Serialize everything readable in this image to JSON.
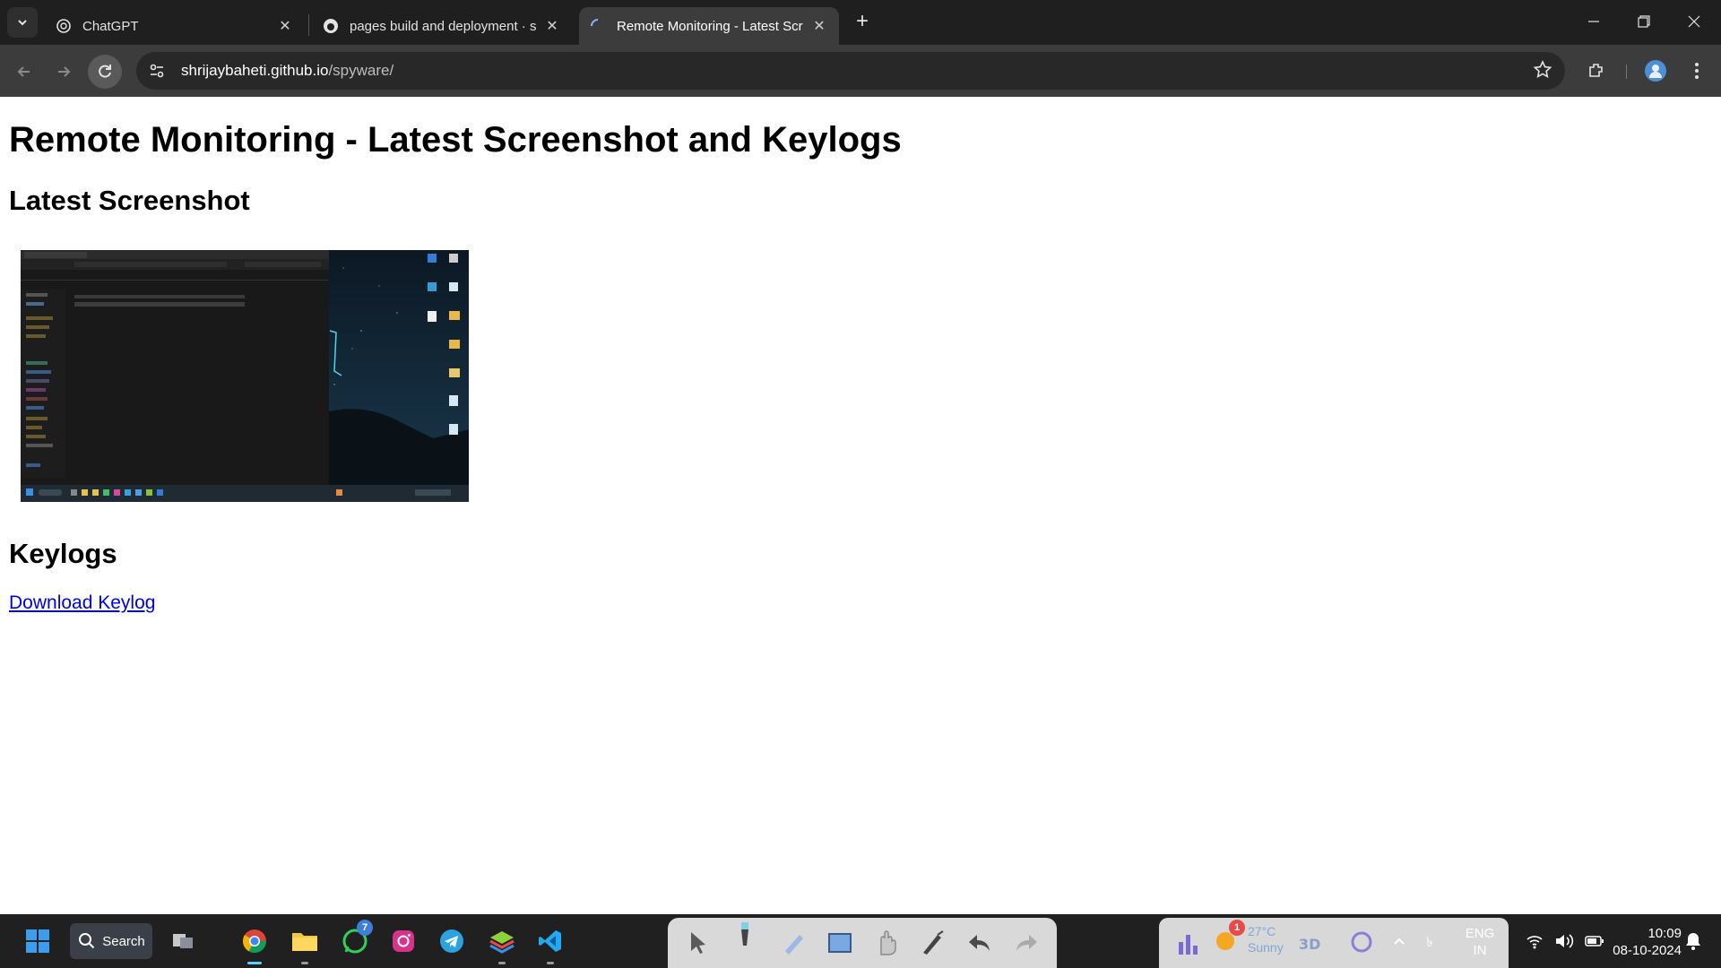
{
  "browser": {
    "tabs": [
      {
        "title": "ChatGPT",
        "active": false
      },
      {
        "title": "pages build and deployment · s",
        "active": false
      },
      {
        "title": "Remote Monitoring - Latest Scr",
        "active": true
      }
    ],
    "url_host": "shrijaybaheti.github.io",
    "url_path": "/spyware/"
  },
  "page": {
    "heading": "Remote Monitoring - Latest Screenshot and Keylogs",
    "screenshot_heading": "Latest Screenshot",
    "keylogs_heading": "Keylogs",
    "download_link": "Download Keylog"
  },
  "taskbar": {
    "search_label": "Search",
    "whatsapp_badge": "7",
    "weather_badge": "1",
    "weather_temp": "27°C",
    "weather_desc": "Sunny",
    "lang_line1": "ENG",
    "lang_line2": "IN",
    "time": "10:09",
    "date": "08-10-2024"
  },
  "colors": {
    "tabbar_bg": "#1f1f1f",
    "toolbar_bg": "#3c3c3c",
    "link": "#0000ee",
    "taskbar_bg": "#202020"
  }
}
